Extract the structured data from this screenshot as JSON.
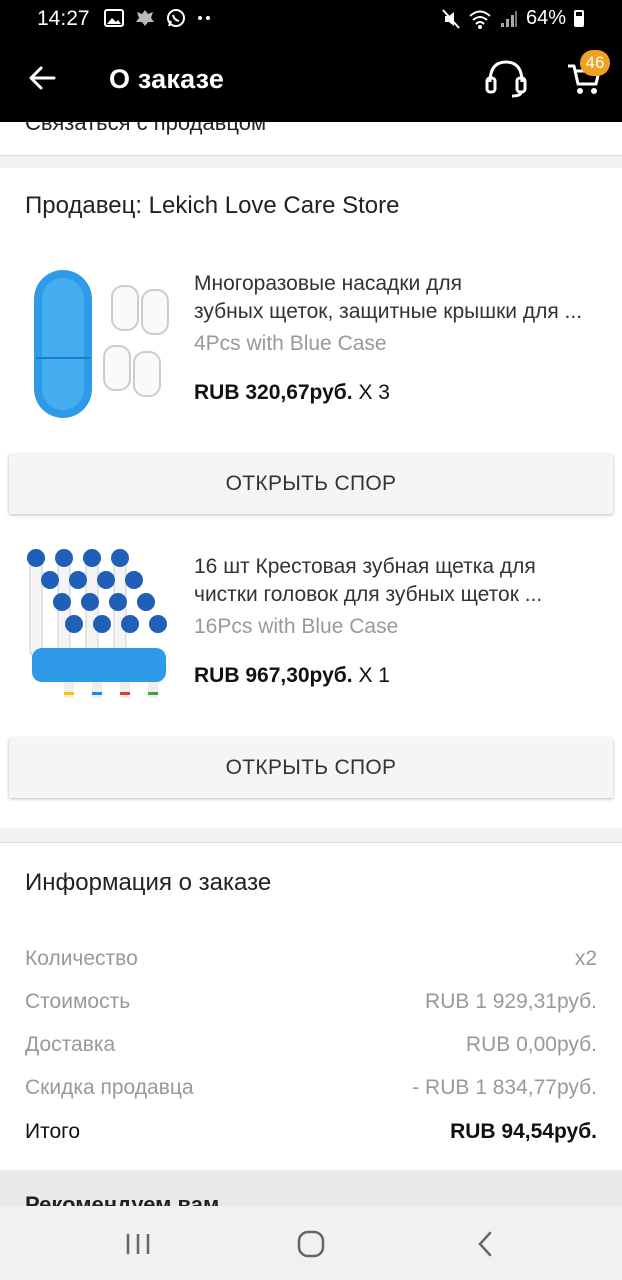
{
  "status_bar": {
    "time": "14:27",
    "battery": "64%",
    "left_icons": [
      "image-icon",
      "emblem-icon",
      "whatsapp-icon",
      "more-dots-icon"
    ],
    "right_icons": [
      "mute-icon",
      "wifi-icon",
      "signal-icon",
      "battery-icon"
    ]
  },
  "app_bar": {
    "title": "О заказе",
    "cart_count": "46",
    "badge_color": "#f2a022"
  },
  "contact_strip": {
    "label": "Связаться с продавцом"
  },
  "seller": {
    "label": "Продавец: Lekich Love Care Store"
  },
  "products": [
    {
      "title_line1": "Многоразовые насадки для",
      "title_line2": "зубных щеток, защитные крышки для ...",
      "variant": "4Pcs with Blue Case",
      "price": "RUB 320,67руб.",
      "qty": "X 3",
      "button": "ОТКРЫТЬ СПОР"
    },
    {
      "title_line1": "16 шт Крестовая зубная щетка для",
      "title_line2": "чистки головок для зубных щеток ...",
      "variant": "16Pcs with Blue Case",
      "price": "RUB 967,30руб.",
      "qty": "X 1",
      "button": "ОТКРЫТЬ СПОР"
    }
  ],
  "order_info": {
    "title": "Информация о заказе",
    "rows": [
      {
        "label": "Количество",
        "value": "x2"
      },
      {
        "label": "Стоимость",
        "value": "RUB 1 929,31руб."
      },
      {
        "label": "Доставка",
        "value": "RUB 0,00руб."
      },
      {
        "label": "Скидка продавца",
        "value": "- RUB 1 834,77руб."
      },
      {
        "label": "Итого",
        "value": "RUB 94,54руб."
      }
    ]
  },
  "recommend": {
    "label": "Рекомендуем вам"
  },
  "nav": {
    "icons": [
      "recent-apps-icon",
      "home-icon",
      "back-icon"
    ]
  }
}
